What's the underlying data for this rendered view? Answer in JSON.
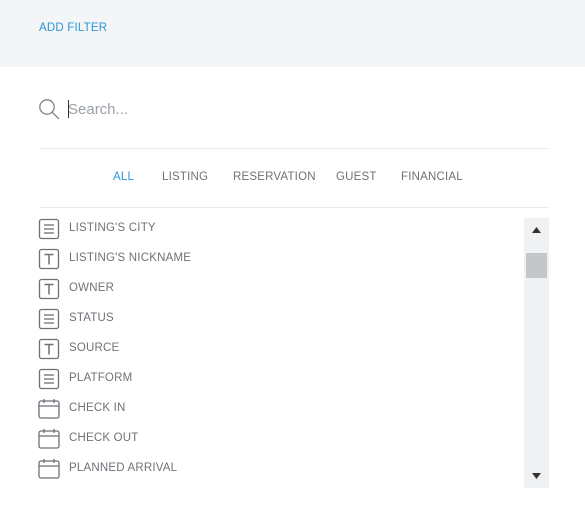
{
  "header": {
    "add_filter_label": "ADD FILTER"
  },
  "search": {
    "placeholder": "Search...",
    "value": ""
  },
  "tabs": [
    {
      "label": "ALL",
      "active": true
    },
    {
      "label": "LISTING",
      "active": false
    },
    {
      "label": "RESERVATION",
      "active": false
    },
    {
      "label": "GUEST",
      "active": false
    },
    {
      "label": "FINANCIAL",
      "active": false
    }
  ],
  "fields": [
    {
      "label": "LISTING'S CITY",
      "icon": "list-icon"
    },
    {
      "label": "LISTING'S NICKNAME",
      "icon": "text-icon"
    },
    {
      "label": "OWNER",
      "icon": "text-icon"
    },
    {
      "label": "STATUS",
      "icon": "list-icon"
    },
    {
      "label": "SOURCE",
      "icon": "text-icon"
    },
    {
      "label": "PLATFORM",
      "icon": "list-icon"
    },
    {
      "label": "CHECK IN",
      "icon": "calendar-icon"
    },
    {
      "label": "CHECK OUT",
      "icon": "calendar-icon"
    },
    {
      "label": "PLANNED ARRIVAL",
      "icon": "calendar-icon"
    }
  ],
  "colors": {
    "accent": "#2a97d4",
    "text": "#6d7277",
    "icon": "#6b7177",
    "header_bg": "#f4f5f7"
  }
}
